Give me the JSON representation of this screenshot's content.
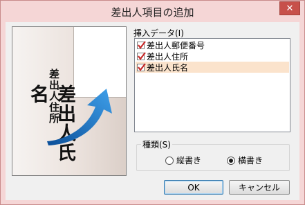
{
  "window": {
    "title": "差出人項目の追加",
    "close_label": "✕"
  },
  "preview": {
    "address_text": "差出人住所",
    "name_text": "差出人氏名"
  },
  "insert_data": {
    "label": "挿入データ(I)",
    "items": [
      {
        "label": "差出人郵便番号",
        "checked": true,
        "selected": false
      },
      {
        "label": "差出人住所",
        "checked": true,
        "selected": false
      },
      {
        "label": "差出人氏名",
        "checked": true,
        "selected": true
      }
    ]
  },
  "type_group": {
    "label": "種類(S)",
    "options": [
      {
        "label": "縦書き",
        "selected": false
      },
      {
        "label": "横書き",
        "selected": true
      }
    ]
  },
  "buttons": {
    "ok": "OK",
    "cancel": "キャンセル"
  },
  "colors": {
    "title_bar": "#f5d6d6",
    "close": "#c7504a",
    "arrow": "#1f7fd0",
    "selection": "#fbe3cc",
    "check": "#c62828"
  }
}
